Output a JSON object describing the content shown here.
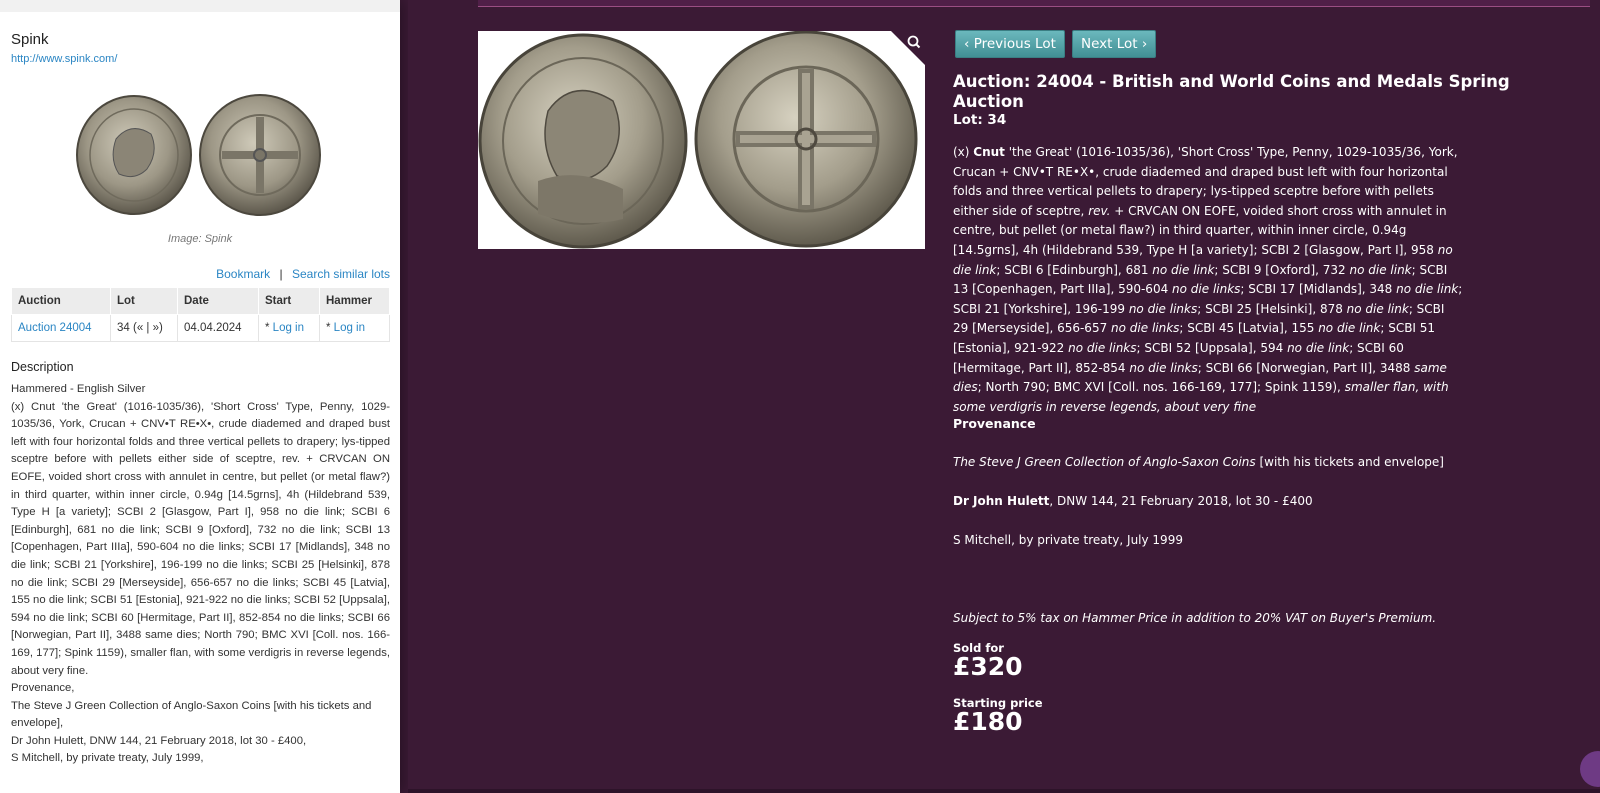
{
  "source": {
    "name": "Spink",
    "url": "http://www.spink.com/",
    "image_credit": "Image: Spink"
  },
  "actions": {
    "bookmark": "Bookmark",
    "separator": "|",
    "search_similar": "Search similar lots"
  },
  "table": {
    "headers": [
      "Auction",
      "Lot",
      "Date",
      "Start",
      "Hammer"
    ],
    "row": {
      "auction": "Auction 24004",
      "lot": "34 (« | »)",
      "date": "04.04.2024",
      "start_prefix": "* ",
      "start_link": "Log in",
      "hammer_prefix": "* ",
      "hammer_link": "Log in"
    }
  },
  "description": {
    "title": "Description",
    "category": "Hammered - English Silver",
    "text": "(x) Cnut 'the Great' (1016-1035/36), 'Short Cross' Type, Penny, 1029-1035/36, York, Crucan + CNV•T RE•X•, crude diademed and draped bust left with four horizontal folds and three vertical pellets to drapery; lys-tipped sceptre before with pellets either side of sceptre, rev. + CRVCAN ON EOFE, voided short cross with annulet in centre, but pellet (or metal flaw?) in third quarter, within inner circle, 0.94g [14.5grns], 4h (Hildebrand 539, Type H [a variety]; SCBI 2 [Glasgow, Part I], 958 no die link; SCBI 6 [Edinburgh], 681 no die link; SCBI 9 [Oxford], 732 no die link; SCBI 13 [Copenhagen, Part IIIa], 590-604 no die links; SCBI 17 [Midlands], 348 no die link; SCBI 21 [Yorkshire], 196-199 no die links; SCBI 25 [Helsinki], 878 no die link; SCBI 29 [Merseyside], 656-657 no die links; SCBI 45 [Latvia], 155 no die link; SCBI 51 [Estonia], 921-922 no die links; SCBI 52 [Uppsala], 594 no die link; SCBI 60 [Hermitage, Part II], 852-854 no die links; SCBI 66 [Norwegian, Part II], 3488 same dies; North 790; BMC XVI [Coll. nos. 166-169, 177]; Spink 1159), smaller flan, with some verdigris in reverse legends, about very fine.",
    "provenance": "Provenance,",
    "prov1": "The Steve J Green Collection of Anglo-Saxon Coins [with his tickets and envelope],",
    "prov2": "Dr John Hulett, DNW 144, 21 February 2018, lot 30 - £400,",
    "prov3": "S Mitchell, by private treaty, July 1999,"
  },
  "nav": {
    "prev": "‹ Previous Lot",
    "next": "Next Lot ›"
  },
  "lot": {
    "title": "Auction: 24004 - British and World Coins and Medals Spring Auction",
    "lot_number": "Lot: 34",
    "body": {
      "intro": "(x) ",
      "ruler": "Cnut",
      "p1": " 'the Great' (1016-1035/36), 'Short Cross' Type, Penny, 1029-1035/36, York, Crucan + CNV•T RE•X•, crude diademed and draped bust left with four horizontal folds and three vertical pellets to drapery; lys-tipped sceptre before with pellets either side of sceptre, ",
      "rev": "rev.",
      "p2": " + CRVCAN ON EOFE, voided short cross with annulet in centre, but pellet (or metal flaw?) in third quarter, within inner circle, 0.94g [14.5grns], 4h (Hildebrand 539, Type H [a variety]; SCBI 2 [Glasgow, Part I], 958 ",
      "ndl1": "no die link",
      "p3": "; SCBI 6 [Edinburgh], 681 ",
      "ndl2": "no die link",
      "p4": "; SCBI 9 [Oxford], 732 ",
      "ndl3": "no die link",
      "p5": "; SCBI 13 [Copenhagen, Part IIIa], 590-604 ",
      "ndl4": "no die links",
      "p6": "; SCBI 17 [Midlands], 348 ",
      "ndl5": "no die link",
      "p7": "; SCBI 21 [Yorkshire], 196-199 ",
      "ndl6": "no die links",
      "p8": "; SCBI 25 [Helsinki], 878 ",
      "ndl7": "no die link",
      "p9": "; SCBI 29 [Merseyside], 656-657 ",
      "ndl8": "no die links",
      "p10": "; SCBI 45 [Latvia], 155 ",
      "ndl9": "no die link",
      "p11": "; SCBI 51 [Estonia], 921-922 ",
      "ndl10": "no die links",
      "p12": "; SCBI 52 [Uppsala], 594 ",
      "ndl11": "no die link",
      "p13": "; SCBI 60 [Hermitage, Part II], 852-854 ",
      "ndl12": "no die links",
      "p14": "; SCBI 66 [Norwegian, Part II], 3488 ",
      "same": "same dies",
      "p15": "; North 790; BMC XVI [Coll. nos. 166-169, 177]; Spink 1159), ",
      "grade": "smaller flan, with some verdigris in reverse legends, about very fine"
    },
    "provenance_heading": "Provenance",
    "prov_green_title": "The Steve J Green Collection of Anglo-Saxon Coins",
    "prov_green_rest": " [with his tickets and envelope]",
    "prov_hulett_name": "Dr John Hulett",
    "prov_hulett_rest": ", DNW 144, 21 February 2018, lot 30 - £400",
    "prov_mitchell": "S Mitchell, by private treaty, July 1999",
    "tax_note": "Subject to 5% tax on Hammer Price in addition to 20% VAT on Buyer's Premium.",
    "sold_label": "Sold for",
    "sold_value": "£320",
    "start_label": "Starting price",
    "start_value": "£180"
  },
  "colors": {
    "panel_bg": "#3b1a35",
    "button": "#4f9fa4",
    "link": "#2b86c4"
  },
  "icons": [
    "zoom-icon",
    "chat-icon"
  ]
}
